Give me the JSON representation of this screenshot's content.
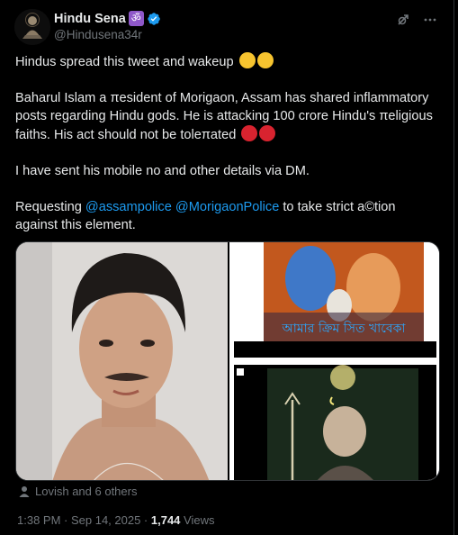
{
  "author": {
    "name": "Hindu Sena",
    "badge_glyph": "ॐ",
    "handle": "@Hindusena34r"
  },
  "header_icons": [
    "grok-icon",
    "more-icon"
  ],
  "tweet": {
    "line1": "Hindus spread this tweet and wakeup",
    "para2": "Baharul Islam a πesident of Morigaon, Assam has shared inflammatory posts regarding Hindu gods. He is attacking 100 crore Hindu's πeligious faiths. His act should not be toleπated",
    "para3": "I have sent his mobile no and other details via DM.",
    "para4_prefix": "Requesting",
    "mention1": "@assampolice",
    "mention2": "@MorigaonPolice",
    "para4_suffix": "to take strict a©tion against this element."
  },
  "media": {
    "bengali_caption": "আমার ক্রিম সিত খাবেকা"
  },
  "tagged": {
    "text": "Lovish and 6 others"
  },
  "meta": {
    "time": "1:38 PM · Sep 14, 2025 · ",
    "views_count": "1,744",
    "views_label": " Views"
  },
  "colors": {
    "accent": "#1d9bf0",
    "muted": "#71767b",
    "text": "#e7e9ea",
    "bg": "#000000",
    "om_badge": "#8f58c9"
  }
}
